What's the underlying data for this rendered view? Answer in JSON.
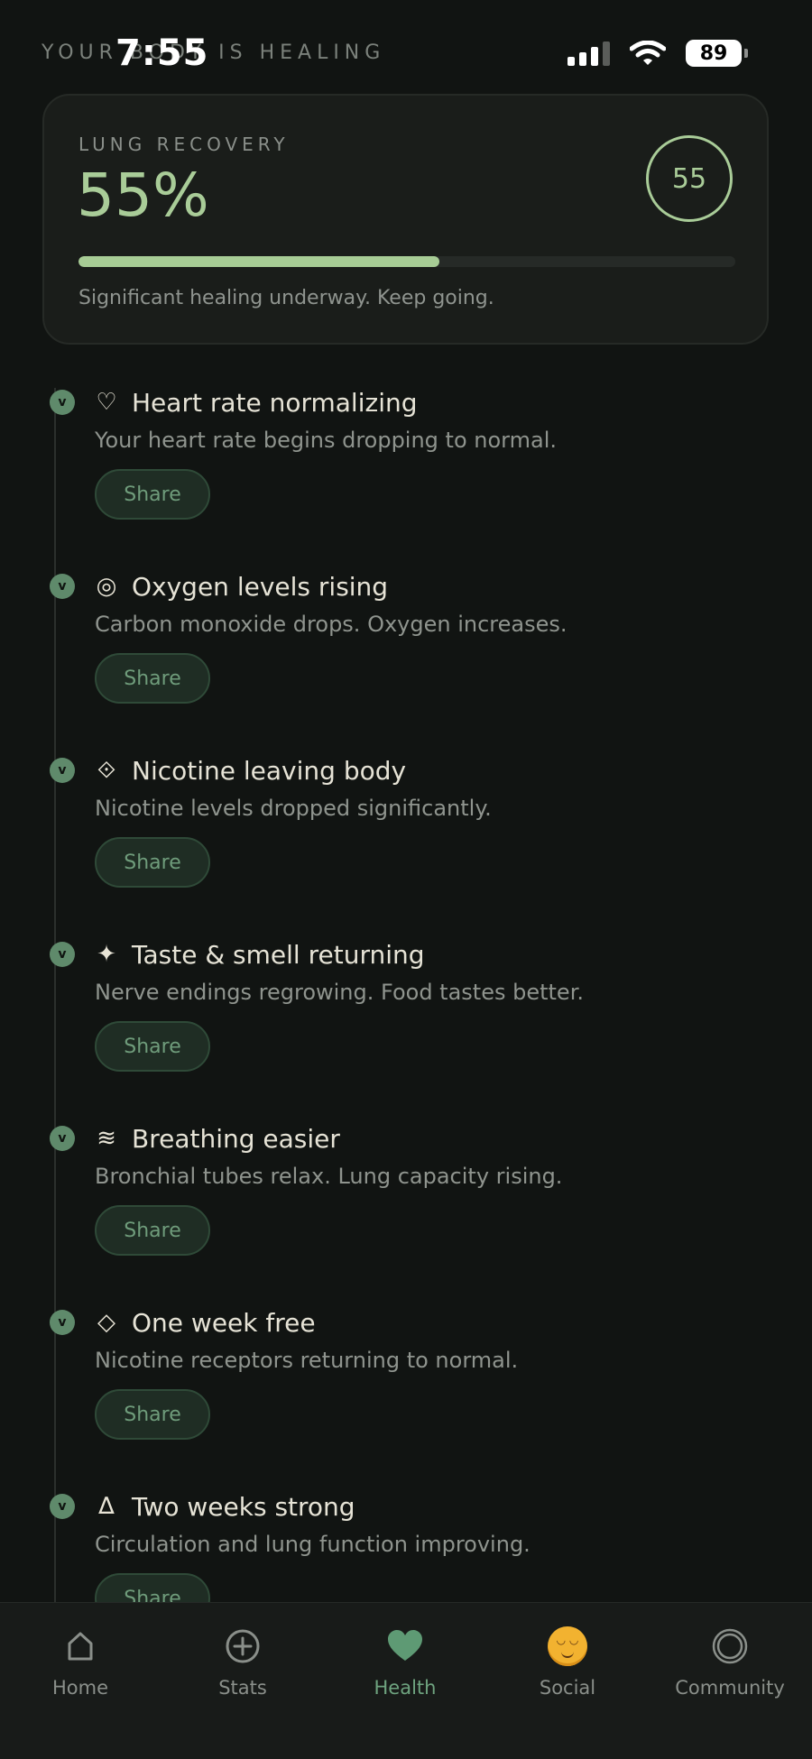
{
  "status_bar": {
    "time": "7:55",
    "battery": "89"
  },
  "section_eyebrow": "YOUR BODY IS HEALING",
  "recovery_card": {
    "label": "LUNG RECOVERY",
    "percent_text": "55%",
    "ring_value": "55",
    "progress_fraction": 0.55,
    "caption": "Significant healing underway. Keep going."
  },
  "milestones": [
    {
      "dot": "v",
      "icon": "♡",
      "title": "Heart rate normalizing",
      "desc": "Your heart rate begins dropping to normal.",
      "share_label": "Share"
    },
    {
      "dot": "v",
      "icon": "◎",
      "title": "Oxygen levels rising",
      "desc": "Carbon monoxide drops. Oxygen increases.",
      "share_label": "Share"
    },
    {
      "dot": "v",
      "icon": "⟐",
      "title": "Nicotine leaving body",
      "desc": "Nicotine levels dropped significantly.",
      "share_label": "Share"
    },
    {
      "dot": "v",
      "icon": "✦",
      "title": "Taste & smell returning",
      "desc": "Nerve endings regrowing. Food tastes better.",
      "share_label": "Share"
    },
    {
      "dot": "v",
      "icon": "≋",
      "title": "Breathing easier",
      "desc": "Bronchial tubes relax. Lung capacity rising.",
      "share_label": "Share"
    },
    {
      "dot": "v",
      "icon": "◇",
      "title": "One week free",
      "desc": "Nicotine receptors returning to normal.",
      "share_label": "Share"
    },
    {
      "dot": "v",
      "icon": "∆",
      "title": "Two weeks strong",
      "desc": "Circulation and lung function improving.",
      "share_label": "Share"
    }
  ],
  "nav": {
    "items": [
      {
        "label": "Home",
        "icon": "home-icon"
      },
      {
        "label": "Stats",
        "icon": "plus-circle-icon"
      },
      {
        "label": "Health",
        "icon": "heart-icon",
        "active": true
      },
      {
        "label": "Social",
        "icon": "smiling-face-icon"
      },
      {
        "label": "Community",
        "icon": "ring-icon"
      }
    ]
  },
  "colors": {
    "accent": "#a9cc98",
    "active_tab": "#6ea37f",
    "background": "#111412"
  }
}
